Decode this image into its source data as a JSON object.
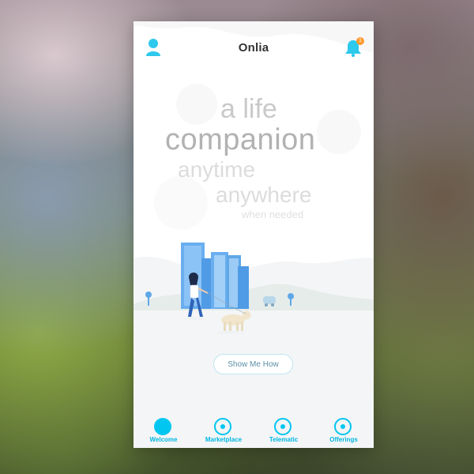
{
  "app": {
    "title": "Onlia",
    "notification_count": "1"
  },
  "hero": {
    "line1": "a life",
    "line2": "companion",
    "line3": "anytime",
    "line4": "anywhere",
    "line5": "when needed"
  },
  "cta": {
    "label": "Show Me How"
  },
  "tabs": [
    {
      "label": "Welcome",
      "icon": "welcome-icon",
      "active": true
    },
    {
      "label": "Marketplace",
      "icon": "marketplace-icon",
      "active": false
    },
    {
      "label": "Telematic",
      "icon": "telematic-icon",
      "active": false
    },
    {
      "label": "Offerings",
      "icon": "offerings-icon",
      "active": false
    }
  ],
  "colors": {
    "accent": "#00c6f0",
    "badge": "#ff9a2e",
    "city_blue": "#5fa8e8"
  }
}
